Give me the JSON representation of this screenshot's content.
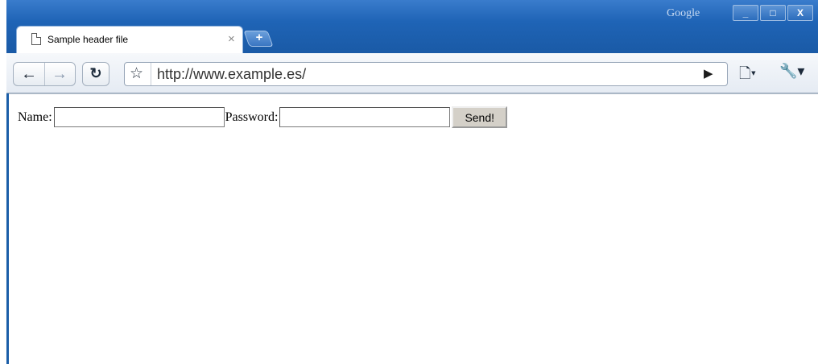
{
  "window": {
    "brand_label": "Google",
    "controls": {
      "minimize": "_",
      "maximize": "□",
      "close": "X"
    }
  },
  "tab": {
    "title": "Sample header file",
    "close": "×"
  },
  "new_tab": {
    "label": "+"
  },
  "toolbar": {
    "url": "http://www.example.es/"
  },
  "form": {
    "name_label": "Name:",
    "name_value": "",
    "password_label": "Password:",
    "password_value": "",
    "submit_label": "Send!"
  }
}
